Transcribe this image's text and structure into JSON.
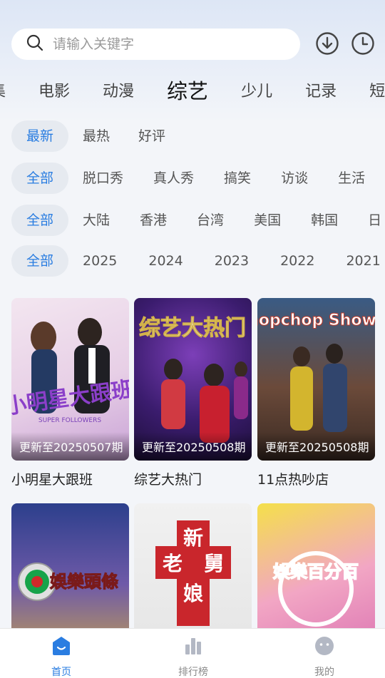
{
  "search": {
    "placeholder": "请输入关键字"
  },
  "header_icons": {
    "download": "download-icon",
    "history": "history-clock-icon"
  },
  "category_tabs": [
    "集",
    "电影",
    "动漫",
    "综艺",
    "少儿",
    "记录",
    "短"
  ],
  "category_active": "综艺",
  "filters": {
    "sort": [
      "最新",
      "最热",
      "好评"
    ],
    "genre": [
      "全部",
      "脱口秀",
      "真人秀",
      "搞笑",
      "访谈",
      "生活"
    ],
    "region": [
      "全部",
      "大陆",
      "香港",
      "台湾",
      "美国",
      "韩国",
      "日"
    ],
    "year": [
      "全部",
      "2025",
      "2024",
      "2023",
      "2022",
      "2021"
    ]
  },
  "shows": [
    {
      "title": "小明星大跟班",
      "update": "更新至20250507期",
      "logo": "小明星大跟班",
      "logo_sub": "SUPER FOLLOWERS"
    },
    {
      "title": "综艺大热门",
      "update": "更新至20250508期",
      "logo": "综艺大热门"
    },
    {
      "title": "11点热吵店",
      "update": "更新至20250508期",
      "logo": "chopchop Show"
    },
    {
      "title": "",
      "update": "",
      "logo": "娛樂頭條"
    },
    {
      "title": "",
      "update": "",
      "logo": "新老舅娘"
    },
    {
      "title": "",
      "update": "",
      "logo": "娛樂百分百"
    }
  ],
  "bottom_nav": [
    {
      "label": "首页",
      "icon": "home-icon"
    },
    {
      "label": "排行榜",
      "icon": "ranking-bars-icon"
    },
    {
      "label": "我的",
      "icon": "profile-icon"
    }
  ],
  "colors": {
    "accent": "#2a7de1",
    "background": "#f3f5f9"
  }
}
